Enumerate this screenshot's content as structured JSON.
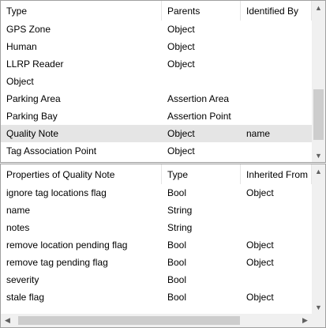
{
  "types_table": {
    "headers": [
      "Type",
      "Parents",
      "Identified By"
    ],
    "rows": [
      {
        "type": "GPS Zone",
        "parents": "Object",
        "identified_by": ""
      },
      {
        "type": "Human",
        "parents": "Object",
        "identified_by": ""
      },
      {
        "type": "LLRP Reader",
        "parents": "Object",
        "identified_by": ""
      },
      {
        "type": "Object",
        "parents": "",
        "identified_by": ""
      },
      {
        "type": "Parking Area",
        "parents": "Assertion Area",
        "identified_by": ""
      },
      {
        "type": "Parking Bay",
        "parents": "Assertion Point",
        "identified_by": ""
      },
      {
        "type": "Quality Note",
        "parents": "Object",
        "identified_by": "name",
        "selected": true
      },
      {
        "type": "Tag Association Point",
        "parents": "Object",
        "identified_by": ""
      }
    ]
  },
  "properties_table": {
    "headers": [
      "Properties of Quality Note",
      "Type",
      "Inherited From"
    ],
    "rows": [
      {
        "property": "ignore tag locations flag",
        "type": "Bool",
        "inherited_from": "Object"
      },
      {
        "property": "name",
        "type": "String",
        "inherited_from": ""
      },
      {
        "property": "notes",
        "type": "String",
        "inherited_from": ""
      },
      {
        "property": "remove location pending flag",
        "type": "Bool",
        "inherited_from": "Object"
      },
      {
        "property": "remove tag pending flag",
        "type": "Bool",
        "inherited_from": "Object"
      },
      {
        "property": "severity",
        "type": "Bool",
        "inherited_from": ""
      },
      {
        "property": "stale flag",
        "type": "Bool",
        "inherited_from": "Object"
      }
    ]
  },
  "icons": {
    "scroll_up": "▲",
    "scroll_down": "▼",
    "scroll_left": "◀",
    "scroll_right": "▶"
  }
}
